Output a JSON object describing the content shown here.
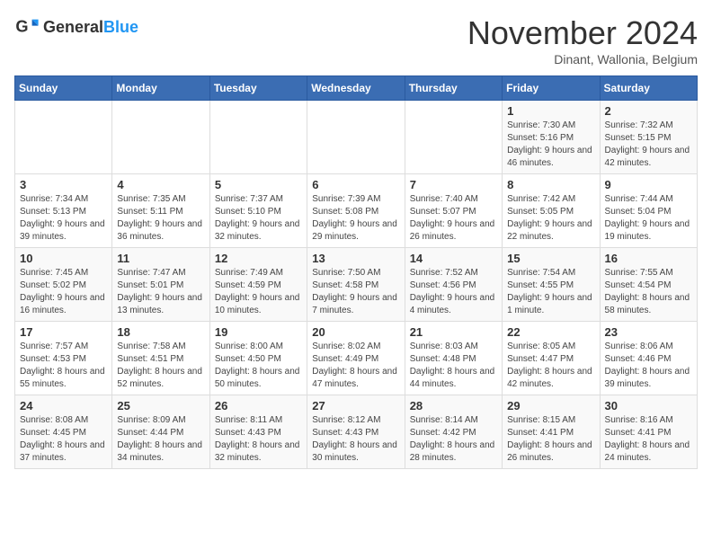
{
  "header": {
    "logo_general": "General",
    "logo_blue": "Blue",
    "month": "November 2024",
    "location": "Dinant, Wallonia, Belgium"
  },
  "days_of_week": [
    "Sunday",
    "Monday",
    "Tuesday",
    "Wednesday",
    "Thursday",
    "Friday",
    "Saturday"
  ],
  "weeks": [
    [
      {
        "day": "",
        "info": ""
      },
      {
        "day": "",
        "info": ""
      },
      {
        "day": "",
        "info": ""
      },
      {
        "day": "",
        "info": ""
      },
      {
        "day": "",
        "info": ""
      },
      {
        "day": "1",
        "info": "Sunrise: 7:30 AM\nSunset: 5:16 PM\nDaylight: 9 hours and 46 minutes."
      },
      {
        "day": "2",
        "info": "Sunrise: 7:32 AM\nSunset: 5:15 PM\nDaylight: 9 hours and 42 minutes."
      }
    ],
    [
      {
        "day": "3",
        "info": "Sunrise: 7:34 AM\nSunset: 5:13 PM\nDaylight: 9 hours and 39 minutes."
      },
      {
        "day": "4",
        "info": "Sunrise: 7:35 AM\nSunset: 5:11 PM\nDaylight: 9 hours and 36 minutes."
      },
      {
        "day": "5",
        "info": "Sunrise: 7:37 AM\nSunset: 5:10 PM\nDaylight: 9 hours and 32 minutes."
      },
      {
        "day": "6",
        "info": "Sunrise: 7:39 AM\nSunset: 5:08 PM\nDaylight: 9 hours and 29 minutes."
      },
      {
        "day": "7",
        "info": "Sunrise: 7:40 AM\nSunset: 5:07 PM\nDaylight: 9 hours and 26 minutes."
      },
      {
        "day": "8",
        "info": "Sunrise: 7:42 AM\nSunset: 5:05 PM\nDaylight: 9 hours and 22 minutes."
      },
      {
        "day": "9",
        "info": "Sunrise: 7:44 AM\nSunset: 5:04 PM\nDaylight: 9 hours and 19 minutes."
      }
    ],
    [
      {
        "day": "10",
        "info": "Sunrise: 7:45 AM\nSunset: 5:02 PM\nDaylight: 9 hours and 16 minutes."
      },
      {
        "day": "11",
        "info": "Sunrise: 7:47 AM\nSunset: 5:01 PM\nDaylight: 9 hours and 13 minutes."
      },
      {
        "day": "12",
        "info": "Sunrise: 7:49 AM\nSunset: 4:59 PM\nDaylight: 9 hours and 10 minutes."
      },
      {
        "day": "13",
        "info": "Sunrise: 7:50 AM\nSunset: 4:58 PM\nDaylight: 9 hours and 7 minutes."
      },
      {
        "day": "14",
        "info": "Sunrise: 7:52 AM\nSunset: 4:56 PM\nDaylight: 9 hours and 4 minutes."
      },
      {
        "day": "15",
        "info": "Sunrise: 7:54 AM\nSunset: 4:55 PM\nDaylight: 9 hours and 1 minute."
      },
      {
        "day": "16",
        "info": "Sunrise: 7:55 AM\nSunset: 4:54 PM\nDaylight: 8 hours and 58 minutes."
      }
    ],
    [
      {
        "day": "17",
        "info": "Sunrise: 7:57 AM\nSunset: 4:53 PM\nDaylight: 8 hours and 55 minutes."
      },
      {
        "day": "18",
        "info": "Sunrise: 7:58 AM\nSunset: 4:51 PM\nDaylight: 8 hours and 52 minutes."
      },
      {
        "day": "19",
        "info": "Sunrise: 8:00 AM\nSunset: 4:50 PM\nDaylight: 8 hours and 50 minutes."
      },
      {
        "day": "20",
        "info": "Sunrise: 8:02 AM\nSunset: 4:49 PM\nDaylight: 8 hours and 47 minutes."
      },
      {
        "day": "21",
        "info": "Sunrise: 8:03 AM\nSunset: 4:48 PM\nDaylight: 8 hours and 44 minutes."
      },
      {
        "day": "22",
        "info": "Sunrise: 8:05 AM\nSunset: 4:47 PM\nDaylight: 8 hours and 42 minutes."
      },
      {
        "day": "23",
        "info": "Sunrise: 8:06 AM\nSunset: 4:46 PM\nDaylight: 8 hours and 39 minutes."
      }
    ],
    [
      {
        "day": "24",
        "info": "Sunrise: 8:08 AM\nSunset: 4:45 PM\nDaylight: 8 hours and 37 minutes."
      },
      {
        "day": "25",
        "info": "Sunrise: 8:09 AM\nSunset: 4:44 PM\nDaylight: 8 hours and 34 minutes."
      },
      {
        "day": "26",
        "info": "Sunrise: 8:11 AM\nSunset: 4:43 PM\nDaylight: 8 hours and 32 minutes."
      },
      {
        "day": "27",
        "info": "Sunrise: 8:12 AM\nSunset: 4:43 PM\nDaylight: 8 hours and 30 minutes."
      },
      {
        "day": "28",
        "info": "Sunrise: 8:14 AM\nSunset: 4:42 PM\nDaylight: 8 hours and 28 minutes."
      },
      {
        "day": "29",
        "info": "Sunrise: 8:15 AM\nSunset: 4:41 PM\nDaylight: 8 hours and 26 minutes."
      },
      {
        "day": "30",
        "info": "Sunrise: 8:16 AM\nSunset: 4:41 PM\nDaylight: 8 hours and 24 minutes."
      }
    ]
  ]
}
